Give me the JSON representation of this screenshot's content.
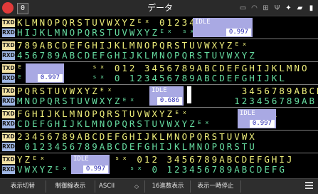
{
  "window": {
    "title": "データ"
  },
  "tags": {
    "tx": "TXD",
    "rx": "RXD"
  },
  "status_icons": [
    "printer-icon",
    "wifi-icon",
    "network-icon",
    "usb-icon",
    "bluetooth-icon",
    "sd-card-icon",
    "battery-icon"
  ],
  "monitor": {
    "blocks": [
      {
        "tx": "KLMNOPQRSTUVWXYZᴱˣ 0123456",
        "rx": "HIJKLMNOPQRSTUVWXYZᴱˣ ˢˣ 0123"
      },
      {
        "tx": "789ABCDEFGHIJKLMNOPQRSTUVWXYZᴱˣ",
        "rx": "456789ABCDEFGHIJKLMNOPQRSTUVWXYZ"
      },
      {
        "tx": "ᴱˣ        ˢˣ 012 3456789ABCDEFGHIJKLMNO",
        "rx": "ᴱˣ        ˢˣ 0 123456789ABCDEFGHIJKL"
      },
      {
        "tx": "PQRSTUVWXYZᴱˣ                 3456789ABCDE",
        "rx": "MNOPQRSTUVWXYZᴱˣ             123456789AB"
      },
      {
        "tx": "FGHIJKLMNOPQRSTUVWXYZᴱˣ       ˢˣ 01",
        "rx": "CDEFGHIJKLMNOPQRSTUVWXYZᴱˣ"
      },
      {
        "tx": "23456789ABCDEFGHIJKLMNOPQRSTUVWX",
        "rx": " 0123456789ABCDEFGHIJKLMNOPQRSTU"
      },
      {
        "tx": "YZᴱˣ         ˢˣ 012 3456789ABCDEFGHIJ",
        "rx": "VWXYZᴱˣ        ˢˣ 0 123456789ABCDEFG"
      }
    ],
    "idle_markers": [
      {
        "label": "IDLE",
        "value": "0.997"
      },
      {
        "label": "IDLE",
        "value": "0.997"
      },
      {
        "label": "IDLE",
        "value": "0.686"
      },
      {
        "label": "IDLE",
        "value": "0.997"
      },
      {
        "label": "IDLE",
        "value": "0.997"
      }
    ]
  },
  "toolbar": {
    "display_switch": "表示切替",
    "control_lines": "制御線表示",
    "encoding_value": "ASCII",
    "hex_display": "16進数表示",
    "pause_display": "表示一時停止"
  }
}
